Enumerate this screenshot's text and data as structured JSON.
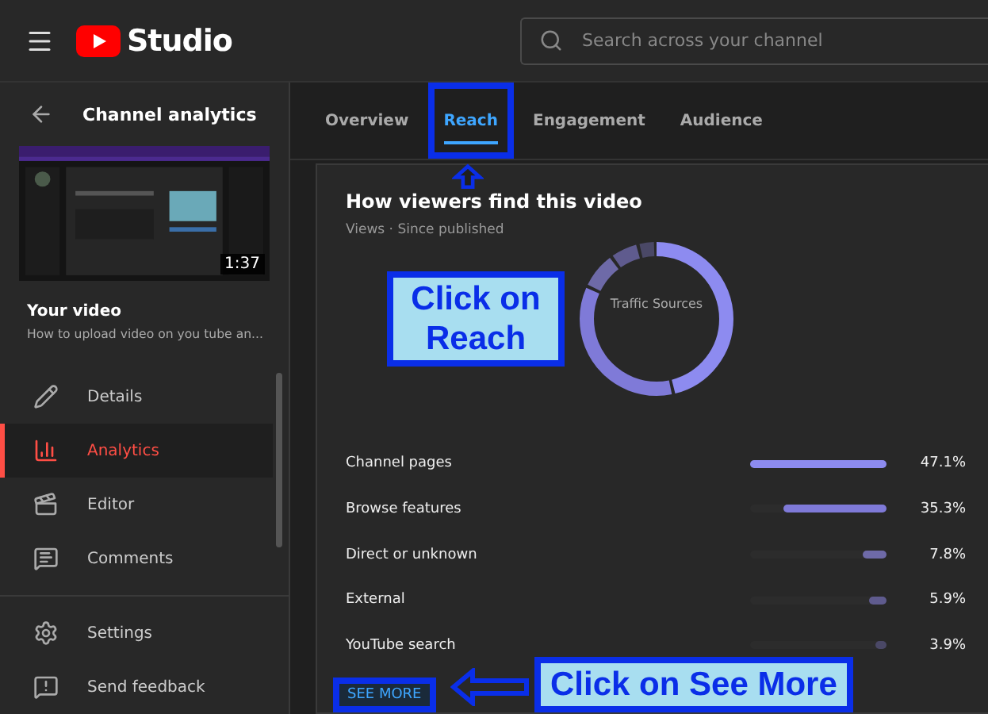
{
  "header": {
    "logo_text": "Studio",
    "search": {
      "placeholder": "Search across your channel"
    }
  },
  "sidebar": {
    "title": "Channel analytics",
    "thumbnail": {
      "kind": "picture",
      "duration": "1:37"
    },
    "video_heading": "Your video",
    "video_title": "How to upload video on you tube an...",
    "items": [
      {
        "label": "Details",
        "selected": false
      },
      {
        "label": "Analytics",
        "selected": true
      },
      {
        "label": "Editor",
        "selected": false
      },
      {
        "label": "Comments",
        "selected": false
      }
    ],
    "footer_items": [
      {
        "label": "Settings"
      },
      {
        "label": "Send feedback"
      }
    ]
  },
  "tabs": [
    {
      "label": "Overview",
      "selected": false,
      "highlighted": false
    },
    {
      "label": "Reach",
      "selected": true,
      "highlighted": true
    },
    {
      "label": "Engagement",
      "selected": false,
      "highlighted": false
    },
    {
      "label": "Audience",
      "selected": false,
      "highlighted": false
    }
  ],
  "card": {
    "title": "How viewers find this video",
    "subtitle": "Views · Since published",
    "donut_label": "Traffic Sources",
    "rows": [
      {
        "name": "Channel pages",
        "level": 1.0,
        "value": "47.1%"
      },
      {
        "name": "Browse features",
        "level": 0.76,
        "value": "35.3%"
      },
      {
        "name": "Direct or unknown",
        "level": 0.17,
        "value": "7.8%"
      },
      {
        "name": "External",
        "level": 0.13,
        "value": "5.9%"
      },
      {
        "name": "YouTube search",
        "level": 0.08,
        "value": "3.9%"
      }
    ],
    "see_more": {
      "label": "SEE MORE",
      "highlighted": true
    }
  },
  "annotations": [
    {
      "text": "Click on Reach"
    },
    {
      "text": "Click on See More"
    }
  ]
}
